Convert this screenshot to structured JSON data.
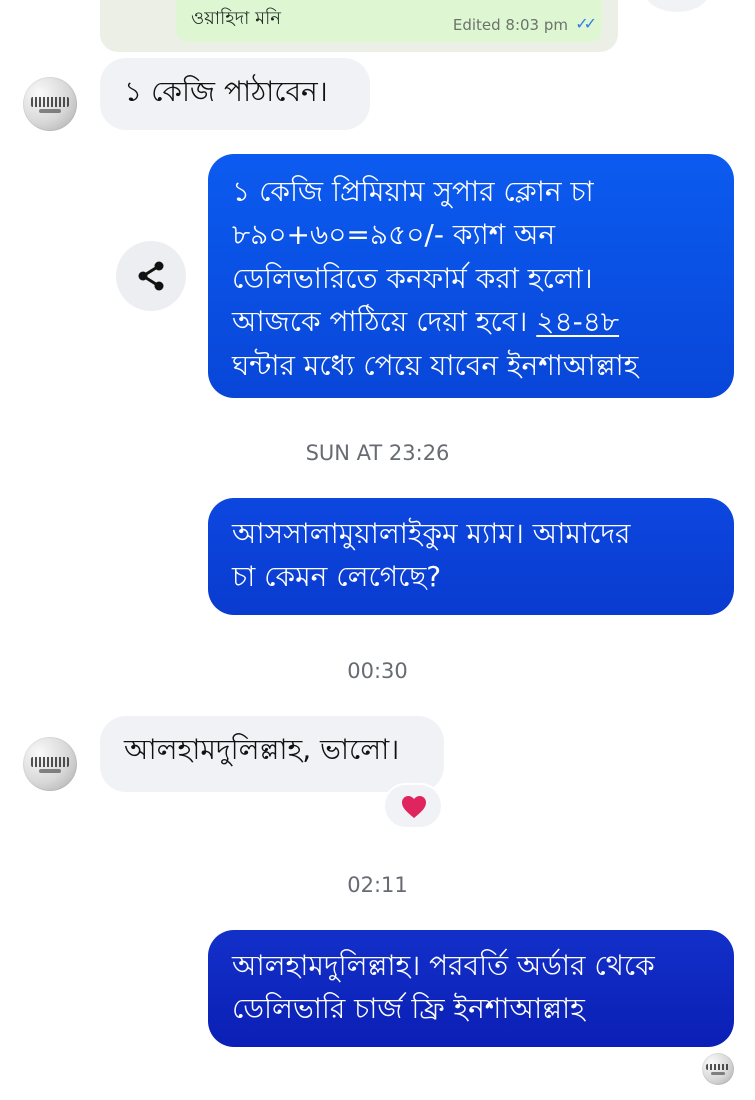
{
  "top_card": {
    "name": "ওয়াহিদা মনি",
    "status": "Edited 8:03 pm",
    "ticks": "✓✓"
  },
  "messages": {
    "in_1": "১ কেজি পাঠাবেন।",
    "out_1": {
      "line1": "১ কেজি প্রিমিয়াম সুপার ক্লোন চা",
      "line2": "৮৯০+৬০=৯৫০/- ক্যাশ অন",
      "line3": "ডেলিভারিতে কনফার্ম করা হলো।",
      "line4_pre": "আজকে পাঠিয়ে দেয়া হবে। ",
      "line4_link": "২৪-৪৮",
      "line5": "ঘন্টার মধ্যে পেয়ে যাবেন ইনশাআল্লাহ"
    },
    "out_2": {
      "line1": "আসসালামুয়ালাইকুম ম্যাম। আমাদের",
      "line2": "চা কেমন লেগেছে?"
    },
    "in_2": "আলহামদুলিল্লাহ, ভালো।",
    "out_3": {
      "line1": "আলহামদুলিল্লাহ। পরবর্তি অর্ডার থেকে",
      "line2": "ডেলিভারি চার্জ ফ্রি ইনশাআল্লাহ"
    }
  },
  "timestamps": {
    "t1": "SUN AT 23:26",
    "t2": "00:30",
    "t3": "02:11"
  },
  "icons": {
    "share": "share-icon",
    "reaction": "heart-icon",
    "read_receipt": "seen-avatar"
  },
  "colors": {
    "outgoing_1": "#0a52e8",
    "outgoing_2": "#0b42d8",
    "outgoing_3": "#0f28c0",
    "incoming": "#f0f2f5",
    "timestamp": "#676b72",
    "heart": "#e0245e"
  }
}
